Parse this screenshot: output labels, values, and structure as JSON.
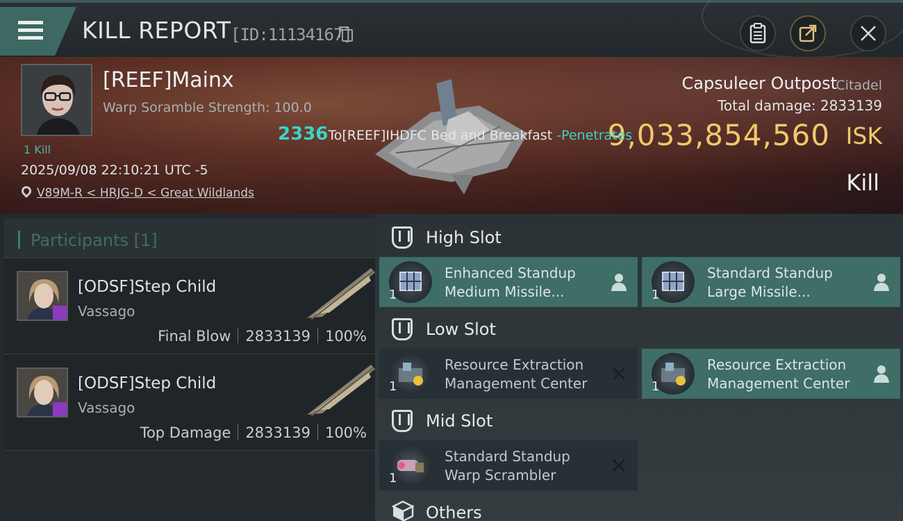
{
  "header": {
    "title": "KILL REPORT",
    "report_id": "[ID:11134167]"
  },
  "victim": {
    "name": "[REEF]Mainx",
    "warp_scramble": "Warp Soramble Strength: 100.0",
    "kill_count": "1 Kill",
    "datetime": "2025/09/08 22:10:21 UTC -5",
    "location": "V89M-R < HRJG-D < Great Wildlands",
    "structure_name": "Capsuleer Outpost",
    "structure_type": "Citadel",
    "total_damage": "Total damage: 2833139",
    "isk_value": "9,033,854,560",
    "isk_unit": "ISK",
    "result": "Kill"
  },
  "event": {
    "damage": "2336",
    "target": "To[REEF]IHDFC Bed and Breakfast ",
    "effect": "-Penetrates"
  },
  "participants": {
    "header": "Participants [1]",
    "rows": [
      {
        "name": "[ODSF]Step Child",
        "ship": "Vassago",
        "role": "Final Blow",
        "damage": "2833139",
        "percent": "100%"
      },
      {
        "name": "[ODSF]Step Child",
        "ship": "Vassago",
        "role": "Top Damage",
        "damage": "2833139",
        "percent": "100%"
      }
    ]
  },
  "slots": {
    "high": {
      "label": "High Slot",
      "modules": [
        {
          "line1": "Enhanced Standup",
          "line2": "Medium Missile...",
          "qty": "1",
          "status": "person-icon"
        },
        {
          "line1": "Standard Standup",
          "line2": "Large Missile...",
          "qty": "1",
          "status": "person-icon"
        }
      ]
    },
    "low": {
      "label": "Low Slot",
      "modules": [
        {
          "line1": "Resource Extraction",
          "line2": "Management Center",
          "qty": "1",
          "status": "destroyed-x-icon"
        },
        {
          "line1": "Resource Extraction",
          "line2": "Management Center",
          "qty": "1",
          "status": "person-icon"
        }
      ]
    },
    "mid": {
      "label": "Mid Slot",
      "modules": [
        {
          "line1": "Standard Standup",
          "line2": "Warp Scrambler",
          "qty": "1",
          "status": "destroyed-x-icon"
        }
      ]
    },
    "others": {
      "label": "Others"
    }
  },
  "colors": {
    "accent_teal": "#3e6e66",
    "isk_gold": "#f2c96a",
    "damage_cyan": "#3cd3c7"
  }
}
